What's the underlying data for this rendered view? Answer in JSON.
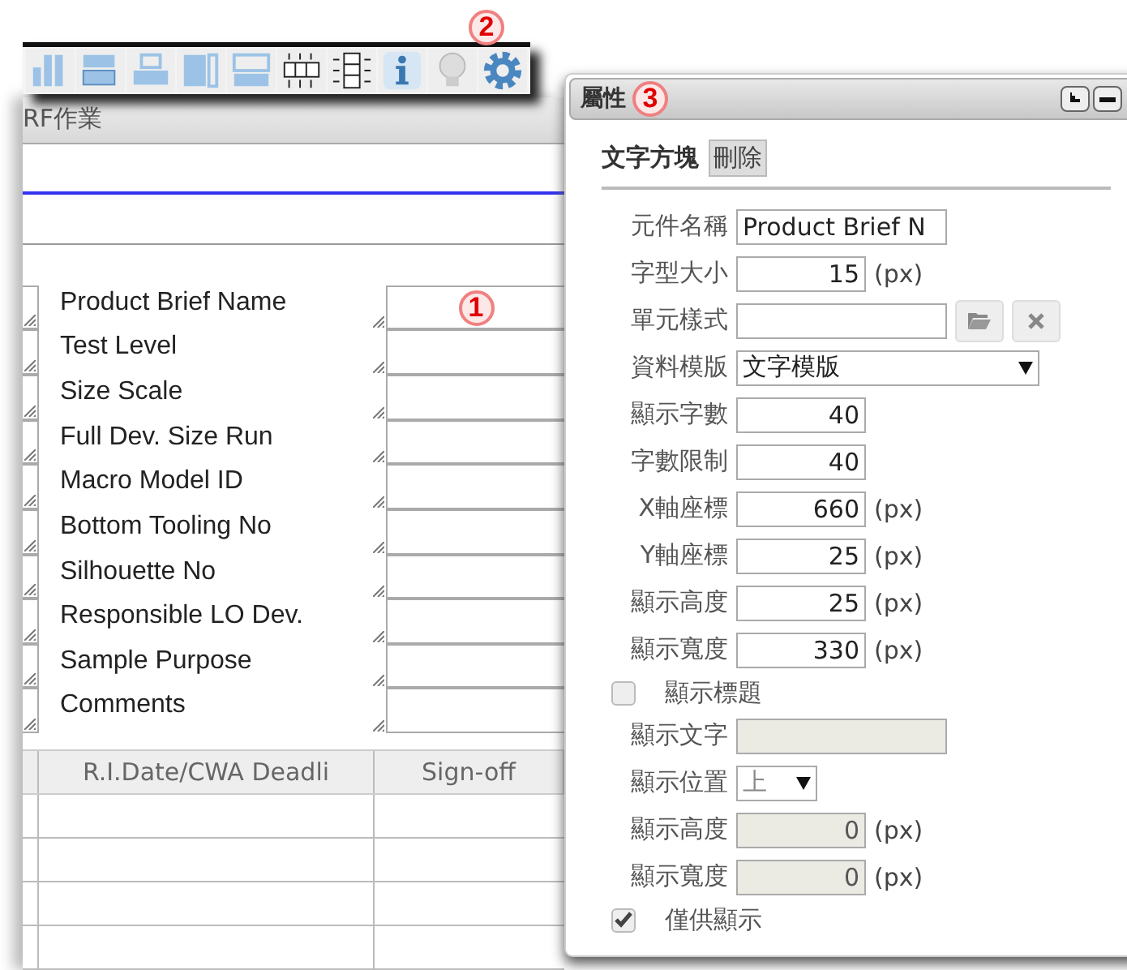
{
  "toolbar": {
    "marker": "2"
  },
  "background_window": {
    "title": "RF作業",
    "form_marker": "1",
    "form_rows": [
      {
        "label": "Product Brief Name"
      },
      {
        "label": "Test Level"
      },
      {
        "label": "Size Scale"
      },
      {
        "label": "Full Dev. Size Run"
      },
      {
        "label": "Macro Model ID"
      },
      {
        "label": "Bottom Tooling No"
      },
      {
        "label": "Silhouette No"
      },
      {
        "label": "Responsible LO Dev."
      },
      {
        "label": "Sample Purpose"
      },
      {
        "label": "Comments"
      }
    ],
    "table": {
      "columns": [
        "R.I.Date/CWA Deadli",
        "Sign-off"
      ]
    }
  },
  "panel": {
    "title": "屬性",
    "marker": "3",
    "element_type": "文字方塊",
    "delete_button": "刪除",
    "fields": [
      {
        "kind": "text",
        "label": "元件名稱",
        "value": "Product Brief N",
        "disabled": false
      },
      {
        "kind": "number",
        "label": "字型大小",
        "value": "15",
        "unit": "(px)",
        "disabled": false
      },
      {
        "kind": "file",
        "label": "單元樣式"
      },
      {
        "kind": "select",
        "label": "資料模版",
        "value": "文字模版"
      },
      {
        "kind": "number",
        "label": "顯示字數",
        "value": "40",
        "disabled": false
      },
      {
        "kind": "number",
        "label": "字數限制",
        "value": "40",
        "disabled": false
      },
      {
        "kind": "number",
        "label": "X軸座標",
        "value": "660",
        "unit": "(px)",
        "disabled": false
      },
      {
        "kind": "number",
        "label": "Y軸座標",
        "value": "25",
        "unit": "(px)",
        "disabled": false
      },
      {
        "kind": "number",
        "label": "顯示高度",
        "value": "25",
        "unit": "(px)",
        "disabled": false
      },
      {
        "kind": "number",
        "label": "顯示寬度",
        "value": "330",
        "unit": "(px)",
        "disabled": false
      },
      {
        "kind": "checkbox",
        "label": "顯示標題",
        "checked": false
      },
      {
        "kind": "text",
        "label": "顯示文字",
        "disabled": true
      },
      {
        "kind": "compact_select",
        "label": "顯示位置",
        "value": "上"
      },
      {
        "kind": "number",
        "label": "顯示高度",
        "value": "0",
        "unit": "(px)",
        "disabled": true
      },
      {
        "kind": "number",
        "label": "顯示寬度",
        "value": "0",
        "unit": "(px)",
        "disabled": true
      },
      {
        "kind": "checkbox",
        "label": "僅供顯示",
        "checked": true
      }
    ]
  }
}
